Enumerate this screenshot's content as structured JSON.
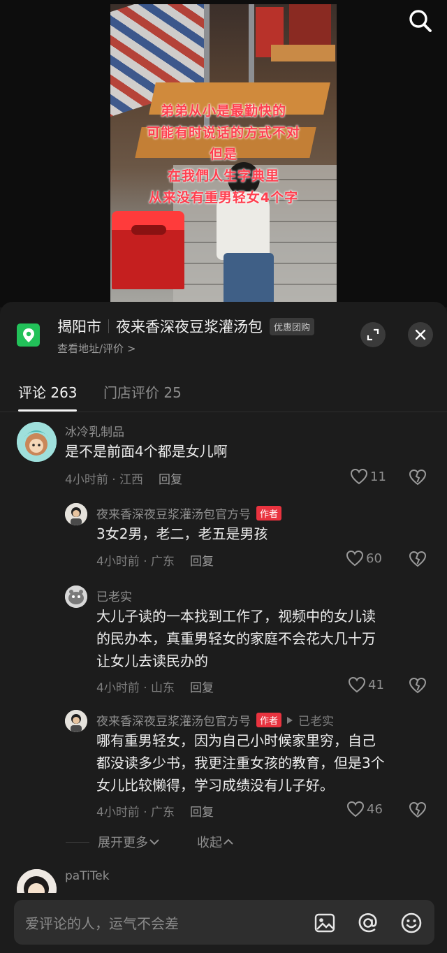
{
  "video": {
    "caption_lines": [
      "弟弟从小是最勤快的",
      "可能有时说话的方式不对",
      "但是",
      "在我們人生字典里",
      "从来没有重男轻女4个字"
    ],
    "search_icon": "search-icon"
  },
  "location": {
    "city": "揭阳市",
    "name": "夜来香深夜豆浆灌汤包",
    "badge": "优惠团购",
    "sub": "查看地址/评价 >",
    "accent_color": "#22c159"
  },
  "tabs": [
    {
      "label": "评论 263",
      "active": true
    },
    {
      "label": "门店评价 25",
      "active": false
    }
  ],
  "comments": [
    {
      "user": "冰冷乳制品",
      "text": "是不是前面4个都是女儿啊",
      "time": "4小时前 · 江西",
      "reply": "回复",
      "likes": "11"
    },
    {
      "user": "夜来香深夜豆浆灌汤包官方号",
      "tag": "作者",
      "text": "3女2男，老二，老五是男孩",
      "time": "4小时前 · 广东",
      "reply": "回复",
      "likes": "60"
    },
    {
      "user": "已老实",
      "text_lines": [
        "大儿子读的一本找到工作了，视频中的女儿读",
        "的民办本，真重男轻女的家庭不会花大几十万",
        "让女儿去读民办的"
      ],
      "time": "4小时前 · 山东",
      "reply": "回复",
      "likes": "41"
    },
    {
      "user": "夜来香深夜豆浆灌汤包官方号",
      "tag": "作者",
      "reply_to": "已老实",
      "text_lines": [
        "哪有重男轻女，因为自己小时候家里穷，自己",
        "都没读多少书，我更注重女孩的教育，但是3个",
        "女儿比较懒得，学习成绩没有儿子好。"
      ],
      "time": "4小时前 · 广东",
      "reply": "回复",
      "likes": "46"
    },
    {
      "user": "paTiTek"
    }
  ],
  "thread": {
    "expand": "展开更多",
    "collapse": "收起"
  },
  "input": {
    "placeholder": "爱评论的人，运气不会差"
  },
  "colors": {
    "author_tag": "#e9333f",
    "background": "#1c1c1c"
  }
}
